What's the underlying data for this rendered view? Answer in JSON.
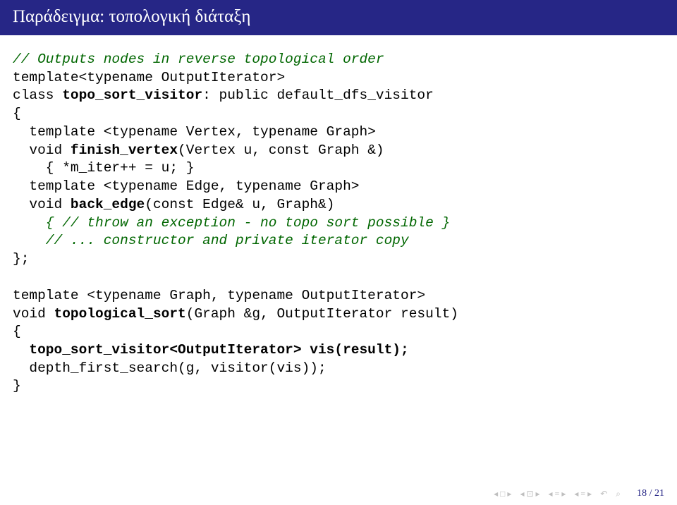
{
  "title": "Παράδειγμα: τοπολογική διάταξη",
  "code": {
    "c1": "// Outputs nodes in reverse topological order",
    "l2": "template<typename OutputIterator>",
    "l3a": "class ",
    "l3b": "topo_sort_visitor",
    "l3c": ": public default_dfs_visitor",
    "l4": "{",
    "l5": "  template <typename Vertex, typename Graph>",
    "l6a": "  void ",
    "l6b": "finish_vertex",
    "l6c": "(Vertex u, const Graph &)",
    "l7": "    { *m_iter++ = u; }",
    "l8": "  template <typename Edge, typename Graph>",
    "l9a": "  void ",
    "l9b": "back_edge",
    "l9c": "(const Edge& u, Graph&)",
    "c10": "    { // throw an exception - no topo sort possible }",
    "c11": "    // ... constructor and private iterator copy",
    "l12": "};",
    "l14": "template <typename Graph, typename OutputIterator>",
    "l15a": "void ",
    "l15b": "topological_sort",
    "l15c": "(Graph &g, OutputIterator result)",
    "l16": "{",
    "l17a": "  ",
    "l17b": "topo_sort_visitor<OutputIterator> vis(result);",
    "l18": "  depth_first_search(g, visitor(vis));",
    "l19": "}"
  },
  "footer": {
    "page": "18 / 21"
  }
}
